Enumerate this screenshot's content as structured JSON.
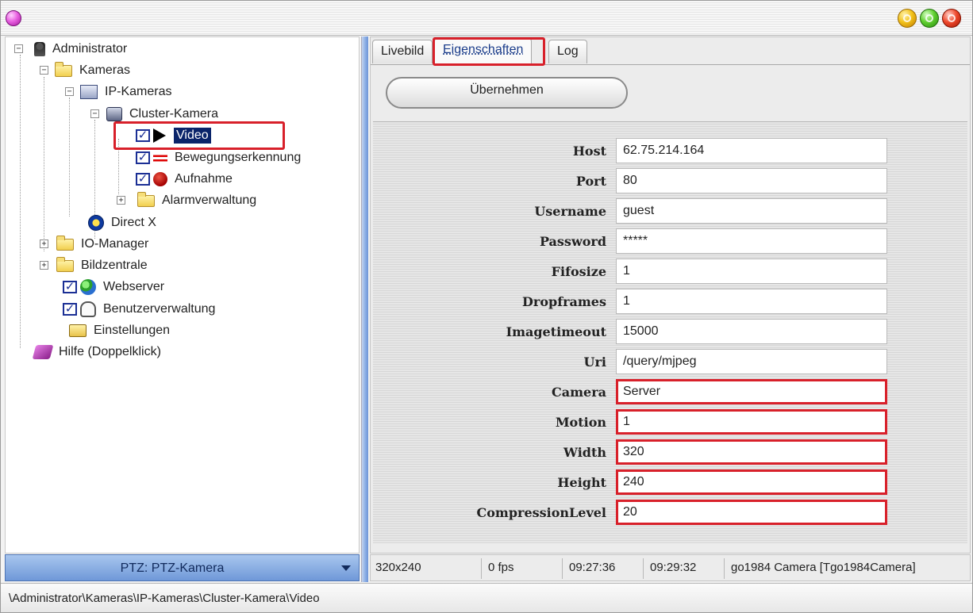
{
  "titlebar": {
    "system_icon": "app-orb-icon",
    "window_controls": [
      "minimize-icon",
      "maximize-icon",
      "close-icon"
    ]
  },
  "tree": {
    "items": [
      {
        "label": "Administrator",
        "icon": "admin-icon",
        "state": "expanded"
      },
      {
        "label": "Kameras",
        "icon": "folder-open-icon",
        "state": "expanded"
      },
      {
        "label": "IP-Kameras",
        "icon": "ip-camera-icon",
        "state": "expanded"
      },
      {
        "label": "Cluster-Kamera",
        "icon": "camera-icon",
        "state": "expanded"
      },
      {
        "label": "Video",
        "icon": "play-icon",
        "checked": true,
        "selected": true
      },
      {
        "label": "Bewegungserkennung",
        "icon": "motion-icon",
        "checked": true
      },
      {
        "label": "Aufnahme",
        "icon": "record-icon",
        "checked": true
      },
      {
        "label": "Alarmverwaltung",
        "icon": "folder-icon",
        "state": "collapsed"
      },
      {
        "label": "Direct X",
        "icon": "directx-icon"
      },
      {
        "label": "IO-Manager",
        "icon": "folder-icon",
        "state": "collapsed"
      },
      {
        "label": "Bildzentrale",
        "icon": "folder-icon",
        "state": "collapsed"
      },
      {
        "label": "Webserver",
        "icon": "globe-icon",
        "checked": true
      },
      {
        "label": "Benutzerverwaltung",
        "icon": "users-icon",
        "checked": true
      },
      {
        "label": "Einstellungen",
        "icon": "settings-icon"
      },
      {
        "label": "Hilfe (Doppelklick)",
        "icon": "help-book-icon"
      }
    ]
  },
  "ptz_select": {
    "value": "PTZ: PTZ-Kamera"
  },
  "tabs": [
    {
      "label": "Livebild"
    },
    {
      "label": "Eigenschaften",
      "active": true
    },
    {
      "label": "Log"
    }
  ],
  "apply_button": {
    "label": "Übernehmen"
  },
  "properties": [
    {
      "name": "Host",
      "value": "62.75.214.164"
    },
    {
      "name": "Port",
      "value": "80"
    },
    {
      "name": "Username",
      "value": "guest"
    },
    {
      "name": "Password",
      "value": "*****"
    },
    {
      "name": "Fifosize",
      "value": "1"
    },
    {
      "name": "Dropframes",
      "value": "1"
    },
    {
      "name": "Imagetimeout",
      "value": "15000"
    },
    {
      "name": "Uri",
      "value": "/query/mjpeg"
    },
    {
      "name": "Camera",
      "value": "Server",
      "highlighted": true
    },
    {
      "name": "Motion",
      "value": "1",
      "highlighted": true
    },
    {
      "name": "Width",
      "value": "320",
      "highlighted": true
    },
    {
      "name": "Height",
      "value": "240",
      "highlighted": true
    },
    {
      "name": "CompressionLevel",
      "value": "20",
      "highlighted": true
    }
  ],
  "statusbar": {
    "resolution": "320x240",
    "fps": "0 fps",
    "time_start": "09:27:36",
    "time_end": "09:29:32",
    "camera": "go1984 Camera [Tgo1984Camera]"
  },
  "path": "\\Administrator\\Kameras\\IP-Kameras\\Cluster-Kamera\\Video",
  "colors": {
    "highlight_red": "#d8202a",
    "selection_blue": "#0a246a",
    "splitter_blue": "#6d94d6"
  }
}
